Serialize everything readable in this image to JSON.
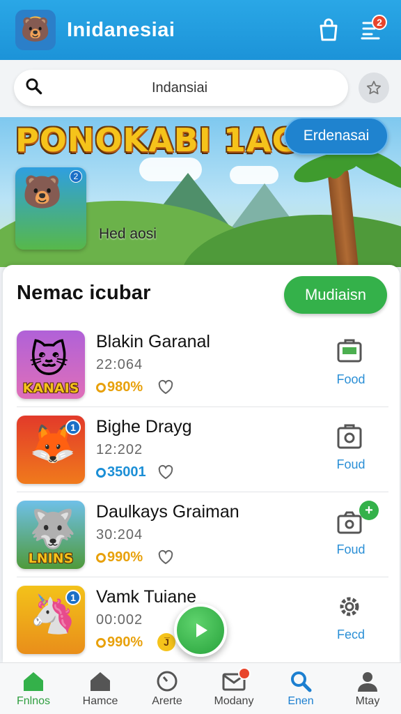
{
  "header": {
    "title": "Inidanesiai",
    "notification_count": "2"
  },
  "search": {
    "query": "Indansiai"
  },
  "banner": {
    "title": "PONOKABI 1AGO",
    "button_label": "Erdenasai",
    "tile_badge": "2",
    "caption": "Hed aosi"
  },
  "list": {
    "heading": "Nemac icubar",
    "button_label": "Mudiaisn",
    "items": [
      {
        "title": "Blakin Garanal",
        "time": "22:064",
        "score": "980%",
        "score_color": "#e8a10c",
        "thumb_caption": "KANAIS",
        "action_label": "Food"
      },
      {
        "title": "Bighe Drayg",
        "time": "12:202",
        "score": "35001",
        "score_color": "#1c8fd6",
        "thumb_badge": "1",
        "action_label": "Foud"
      },
      {
        "title": "Daulkays Graiman",
        "time": "30:204",
        "score": "990%",
        "score_color": "#e8a10c",
        "thumb_caption": "LNINS",
        "action_label": "Foud"
      },
      {
        "title": "Vamk Tuiane",
        "time": "00:002",
        "score": "990%",
        "score_color": "#e8a10c",
        "thumb_badge": "1",
        "extra_badge": "J̅",
        "action_label": "Fecd"
      }
    ]
  },
  "nav": {
    "items": [
      {
        "label": "Fnlnos"
      },
      {
        "label": "Hamce"
      },
      {
        "label": "Arerte"
      },
      {
        "label": "Modany"
      },
      {
        "label": "Enen"
      },
      {
        "label": "Mtay"
      }
    ]
  },
  "colors": {
    "primary": "#1c93d8",
    "accent_green": "#34b14a",
    "badge_red": "#e8452c"
  }
}
